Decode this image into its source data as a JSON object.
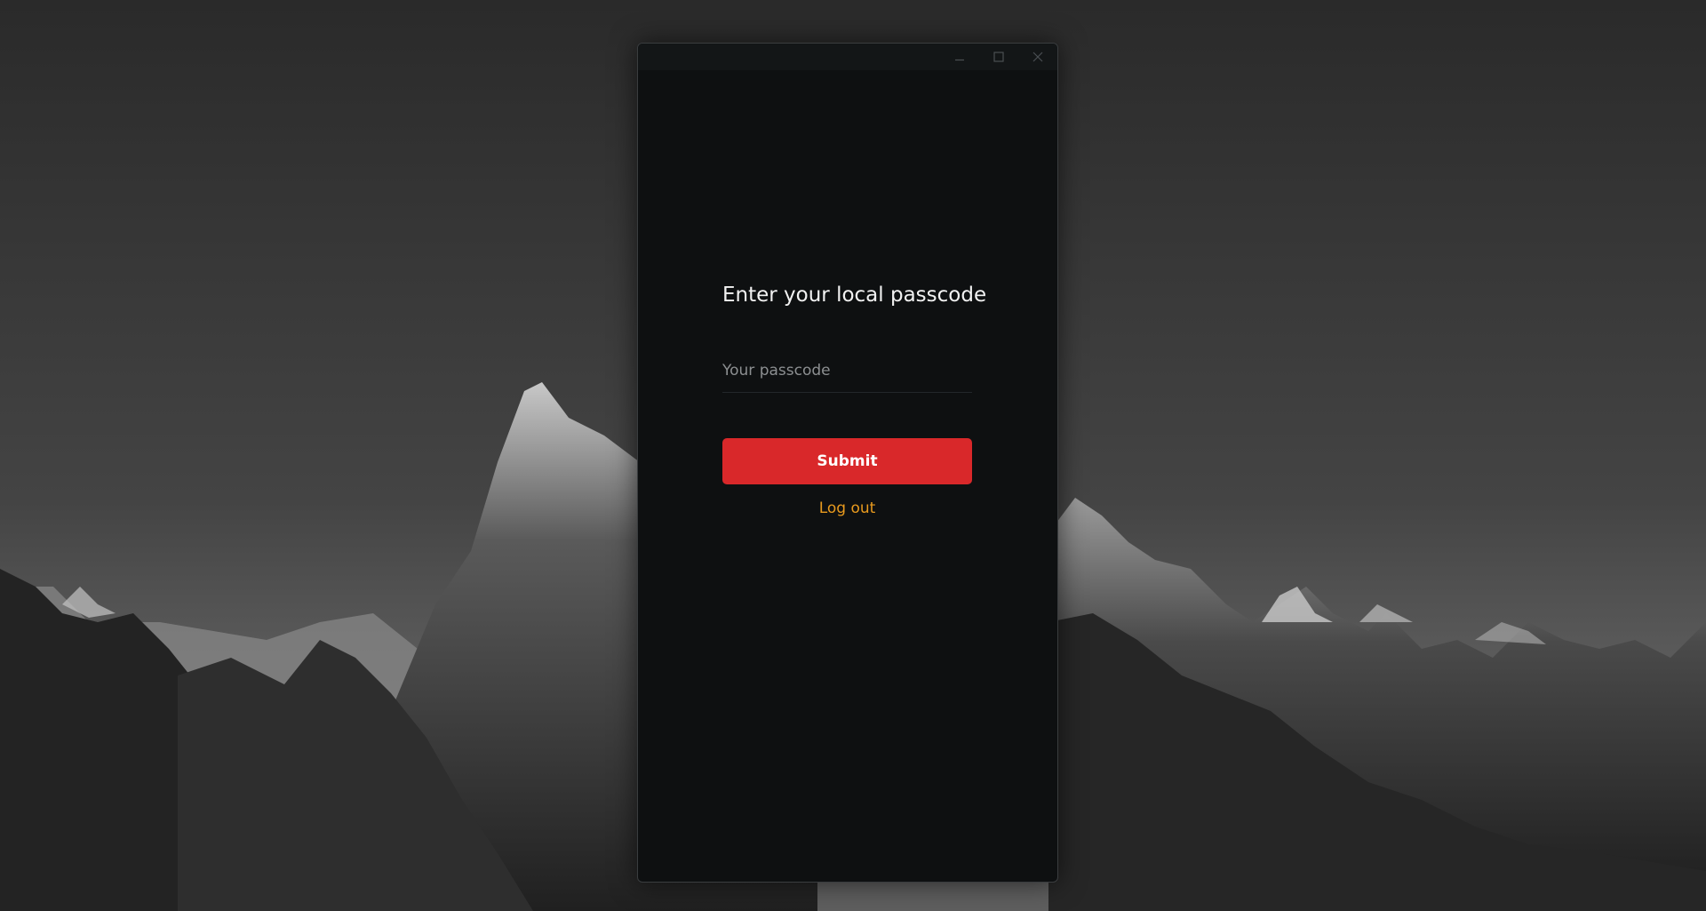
{
  "window": {
    "controls": {
      "minimize_icon": "minimize-icon",
      "maximize_icon": "maximize-icon",
      "close_icon": "close-icon"
    }
  },
  "lock_screen": {
    "title": "Enter your local passcode",
    "passcode_placeholder": "Your passcode",
    "passcode_value": "",
    "submit_label": "Submit",
    "logout_label": "Log out"
  },
  "colors": {
    "window_background": "#0e1011",
    "submit_button": "#d9282a",
    "logout_link": "#e89a1e",
    "title_text": "#f2f2f2",
    "placeholder_text": "#8c8f91"
  }
}
